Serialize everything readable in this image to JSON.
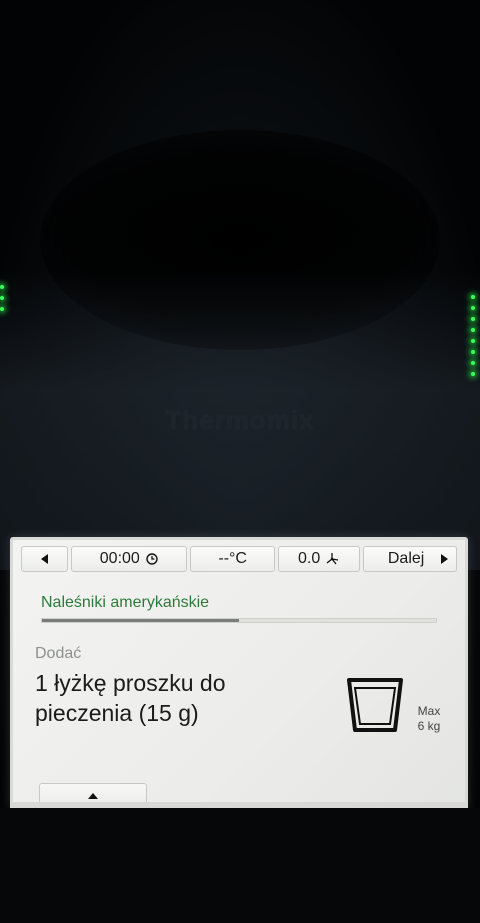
{
  "device": {
    "brand": "Thermomix"
  },
  "topbar": {
    "back_icon": "triangle-left-icon",
    "time_value": "00:00",
    "time_icon": "clock-icon",
    "temperature_value": "--°C",
    "speed_value": "0.0",
    "speed_icon": "fan-icon",
    "next_label": "Dalej",
    "next_icon": "triangle-right-icon"
  },
  "recipe": {
    "title": "Naleśniki amerykańskie",
    "progress_fraction": 0.5
  },
  "step": {
    "label": "Dodać",
    "text": "1 łyżkę proszku do pieczenia (15 g)"
  },
  "scale": {
    "icon": "cup-icon",
    "max_label": "Max",
    "max_value": "6 kg"
  },
  "bottom_tab": {
    "icon": "triangle-up-icon"
  },
  "colors": {
    "title_green": "#2d7a3a",
    "led_green": "#3bff5a"
  }
}
